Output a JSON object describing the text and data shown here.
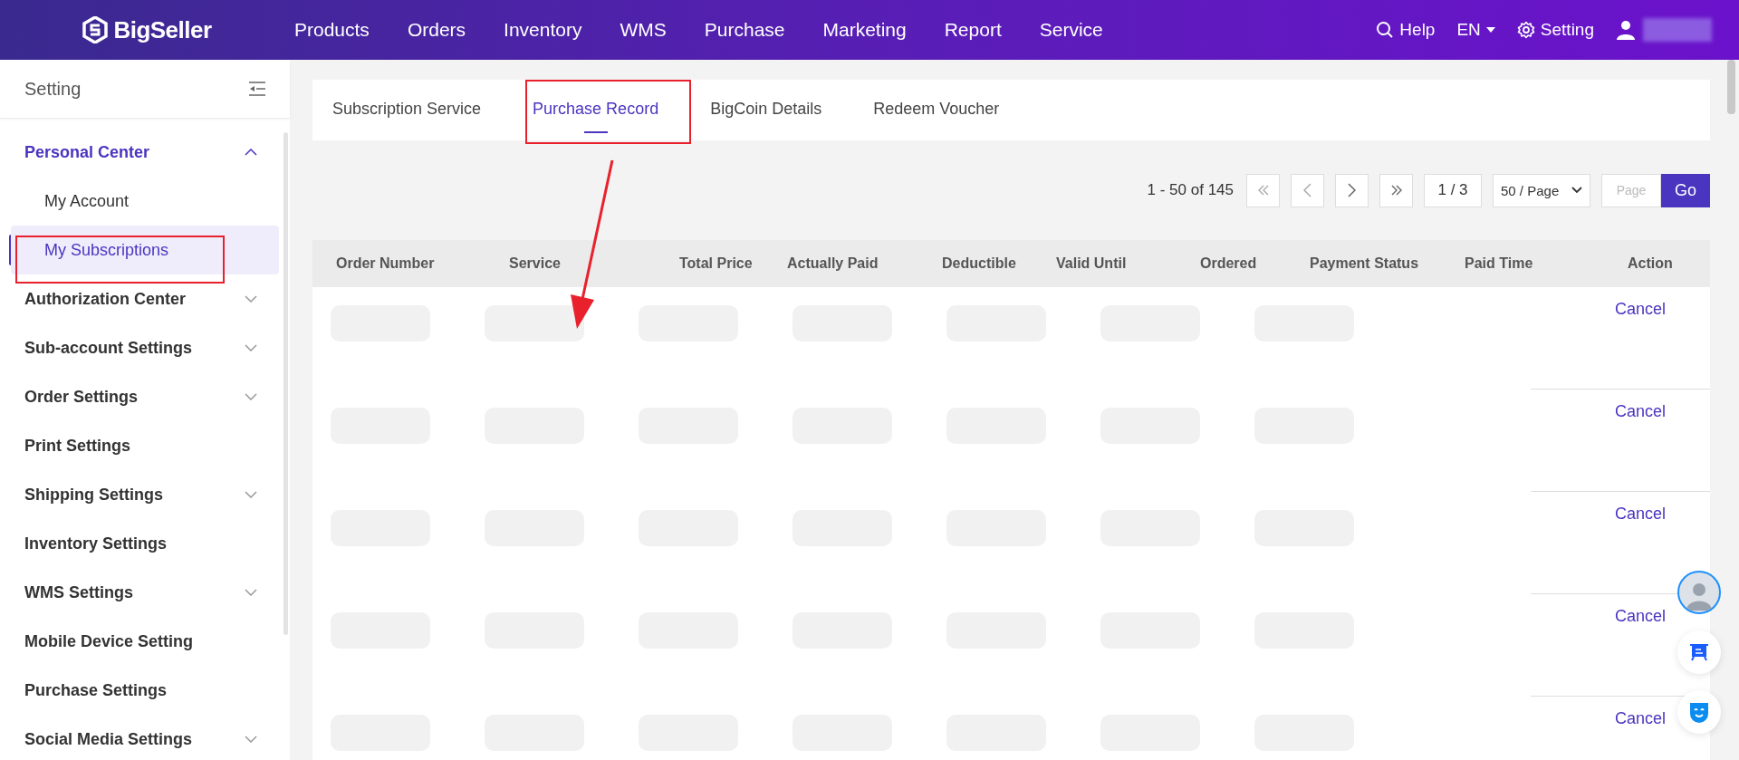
{
  "brand": {
    "name": "BigSeller"
  },
  "nav": [
    "Products",
    "Orders",
    "Inventory",
    "WMS",
    "Purchase",
    "Marketing",
    "Report",
    "Service"
  ],
  "header_right": {
    "help": "Help",
    "language": "EN",
    "setting": "Setting"
  },
  "sidebar": {
    "title": "Setting",
    "items": [
      {
        "label": "Personal Center",
        "expandable": true,
        "expanded": true,
        "children": [
          {
            "label": "My Account",
            "selected": false
          },
          {
            "label": "My Subscriptions",
            "selected": true
          }
        ]
      },
      {
        "label": "Authorization Center",
        "expandable": true,
        "expanded": false
      },
      {
        "label": "Sub-account Settings",
        "expandable": true,
        "expanded": false
      },
      {
        "label": "Order Settings",
        "expandable": true,
        "expanded": false
      },
      {
        "label": "Print Settings",
        "expandable": false,
        "expanded": false
      },
      {
        "label": "Shipping Settings",
        "expandable": true,
        "expanded": false
      },
      {
        "label": "Inventory Settings",
        "expandable": false,
        "expanded": false
      },
      {
        "label": "WMS Settings",
        "expandable": true,
        "expanded": false
      },
      {
        "label": "Mobile Device Setting",
        "expandable": false,
        "expanded": false
      },
      {
        "label": "Purchase Settings",
        "expandable": false,
        "expanded": false
      },
      {
        "label": "Social Media Settings",
        "expandable": true,
        "expanded": false
      }
    ]
  },
  "tabs": [
    {
      "label": "Subscription Service",
      "selected": false
    },
    {
      "label": "Purchase Record",
      "selected": true
    },
    {
      "label": "BigCoin Details",
      "selected": false
    },
    {
      "label": "Redeem Voucher",
      "selected": false
    }
  ],
  "pagination": {
    "summary": "1 - 50 of 145",
    "current": "1 / 3",
    "page_size": "50 / Page",
    "page_input_placeholder": "Page",
    "go": "Go"
  },
  "table": {
    "columns": [
      "Order Number",
      "Service",
      "Total Price",
      "Actually Paid",
      "Deductible",
      "Valid Until",
      "Ordered",
      "Payment Status",
      "Paid Time",
      "Action"
    ],
    "rows": [
      {
        "action": "Cancel"
      },
      {
        "action": "Cancel"
      },
      {
        "action": "Cancel"
      },
      {
        "action": "Cancel"
      },
      {
        "action": "Cancel"
      }
    ]
  }
}
